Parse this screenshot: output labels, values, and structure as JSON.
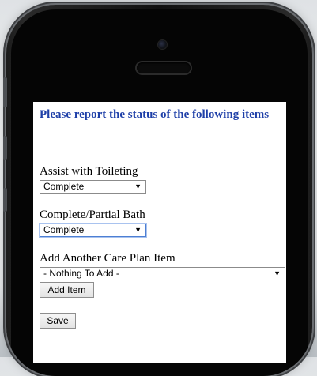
{
  "heading": "Please report the status of the following items",
  "fields": [
    {
      "label": "Assist with Toileting",
      "selected": "Complete"
    },
    {
      "label": "Complete/Partial Bath",
      "selected": "Complete"
    }
  ],
  "add_item": {
    "label": "Add Another Care Plan Item",
    "selected": "- Nothing To Add -",
    "button": "Add Item"
  },
  "save_button": "Save",
  "colors": {
    "heading": "#1e3fa8",
    "focus_border": "#4d7fd3"
  }
}
